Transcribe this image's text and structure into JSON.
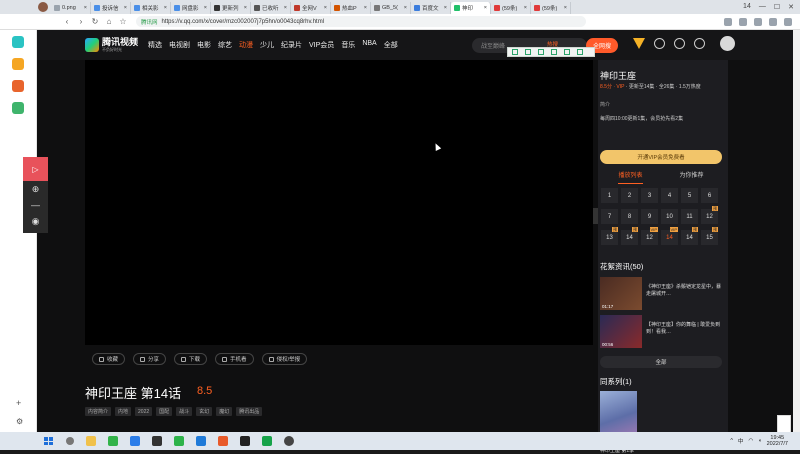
{
  "browser": {
    "tabs": [
      {
        "label": "0.png",
        "color": "#9aa3ad"
      },
      {
        "label": "投诉信",
        "color": "#4a8fe8"
      },
      {
        "label": "相关影",
        "color": "#4a8fe8"
      },
      {
        "label": "网盘影",
        "color": "#4a8fe8"
      },
      {
        "label": "更新列",
        "color": "#333333"
      },
      {
        "label": "已收听",
        "color": "#555555"
      },
      {
        "label": "全网V",
        "color": "#c0392b"
      },
      {
        "label": "热血P",
        "color": "#d35400"
      },
      {
        "label": "GB_5(",
        "color": "#777777"
      },
      {
        "label": "百度文",
        "color": "#3b7ddd"
      },
      {
        "label": "神印",
        "color": "#21c06a",
        "active": true
      },
      {
        "label": "(59条)",
        "color": "#e03a3a"
      },
      {
        "label": "(59条)",
        "color": "#e03a3a"
      }
    ],
    "tab_count": "14",
    "address": {
      "badge": "腾讯网",
      "url": "https://v.qq.com/x/cover/mzc002007j7p5hn/o0043cq8rhv.html"
    }
  },
  "header": {
    "logo_title": "腾讯视频",
    "logo_slogan": "不负好时光",
    "nav": [
      {
        "label": "精选"
      },
      {
        "label": "电视剧"
      },
      {
        "label": "电影"
      },
      {
        "label": "综艺"
      },
      {
        "label": "动漫",
        "highlight": true
      },
      {
        "label": "少儿"
      },
      {
        "label": "纪录片"
      },
      {
        "label": "VIP会员"
      },
      {
        "label": "音乐"
      },
      {
        "label": "NBA"
      },
      {
        "label": "全部"
      }
    ],
    "search_placeholder": "战至巅峰",
    "hot_label": "热搜",
    "search_button": "全网搜"
  },
  "actions": [
    {
      "label": "收藏",
      "icon": "star-icon"
    },
    {
      "label": "分享",
      "icon": "share-icon"
    },
    {
      "label": "下载",
      "icon": "download-icon"
    },
    {
      "label": "手机看",
      "icon": "phone-icon"
    },
    {
      "label": "侵权/举报",
      "icon": "warning-icon"
    }
  ],
  "video": {
    "title": "神印王座 第14话",
    "rating": "8.5",
    "tags": [
      "内容简介",
      "内地",
      "2022",
      "国配",
      "战斗",
      "玄幻",
      "魔幻",
      "腾讯出品"
    ]
  },
  "panel": {
    "name": "神印王座",
    "meta_score": "8.5分 · VIP",
    "meta_rest": " · 更新至14集 · 全26集 · 1.5万热度",
    "brief": "简介",
    "update_note": "每周四10:00更新1集，会员抢先看2集",
    "vip_button": "开通VIP会员免费看",
    "tabs": [
      "播放列表",
      "为你推荐"
    ],
    "episodes": [
      {
        "n": "1"
      },
      {
        "n": "2"
      },
      {
        "n": "3"
      },
      {
        "n": "4"
      },
      {
        "n": "5"
      },
      {
        "n": "6"
      },
      {
        "n": "7"
      },
      {
        "n": "8"
      },
      {
        "n": "9"
      },
      {
        "n": "10"
      },
      {
        "n": "11"
      },
      {
        "n": "12",
        "badge": "预"
      },
      {
        "n": "13",
        "badge": "预"
      },
      {
        "n": "14",
        "badge": "预"
      },
      {
        "n": "12",
        "badge": "VIP"
      },
      {
        "n": "14",
        "badge": "VIP",
        "current": true
      },
      {
        "n": "14",
        "badge": "预"
      },
      {
        "n": "15",
        "badge": "预"
      }
    ],
    "news_heading": "花絮资讯(50)",
    "news": [
      {
        "text": "《神印王座》杀鬃铠定龙星中，暴走屠城开…",
        "duration": "01:17"
      },
      {
        "text": "【神印王座】你的舞临 | 敢爱负到到！看我…",
        "duration": "00:56"
      }
    ],
    "all_button": "全部",
    "series_heading": "同系列(1)",
    "series_item": "神印王座 第1季"
  },
  "taskbar": {
    "time": "19:45",
    "date": "2022/7/7",
    "lang": "中"
  }
}
